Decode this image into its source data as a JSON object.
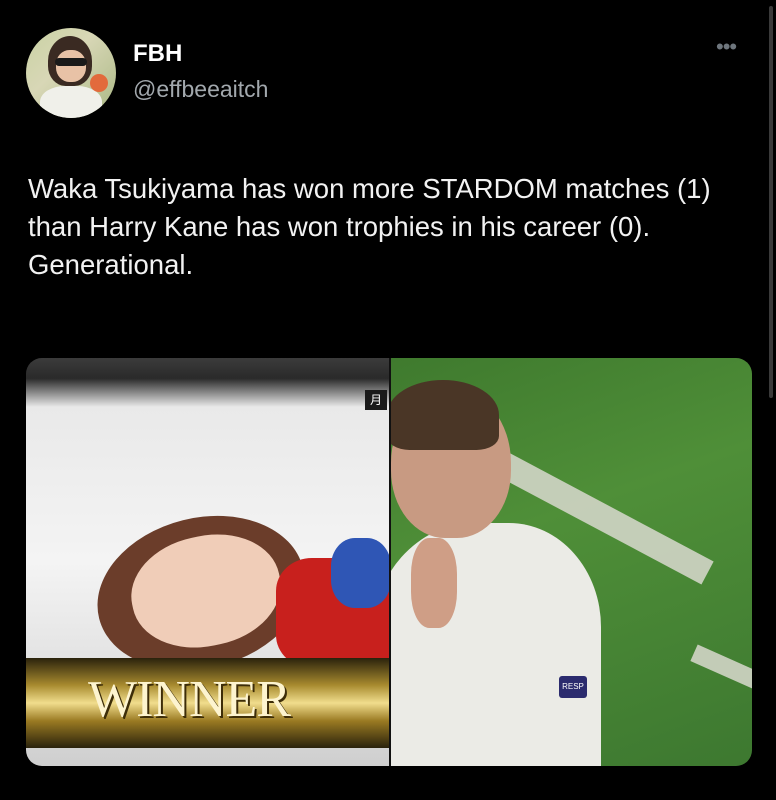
{
  "author": {
    "name": "FBH",
    "handle": "@effbeeaitch"
  },
  "more_icon": "•••",
  "tweet": {
    "text": "Waka Tsukiyama has won more STARDOM matches (1) than Harry Kane has won trophies in his career (0). Generational."
  },
  "media": {
    "left_banner": "WINNER",
    "left_corner_tag": "月",
    "right_sleeve_badge": "RESP"
  },
  "colors": {
    "background": "#000000",
    "text": "#e7e9ea",
    "handle": "#a2a8ad"
  }
}
